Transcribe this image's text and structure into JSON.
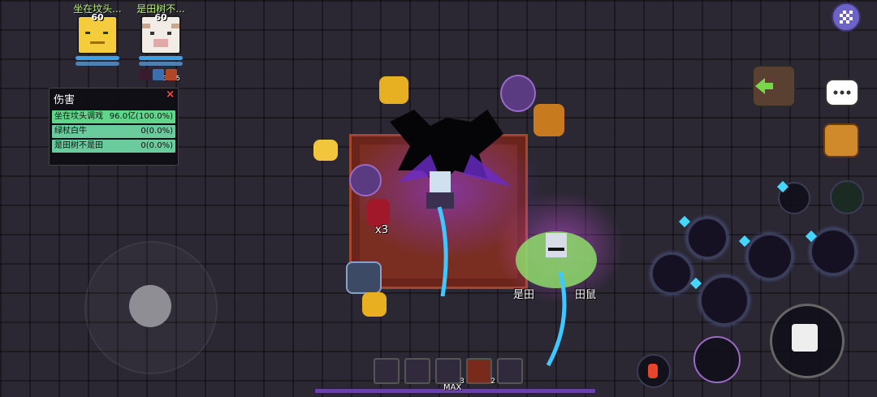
{
  "party": [
    {
      "name": "坐在坟头...",
      "level": "60"
    },
    {
      "name": "是田树不...",
      "level": "60"
    }
  ],
  "buffs": [
    {
      "icon": "dark-buff-icon",
      "count": ""
    },
    {
      "icon": "ice-buff-icon",
      "count": "3"
    },
    {
      "icon": "fire-buff-icon",
      "count": "5"
    }
  ],
  "damage_panel": {
    "title": "伤害",
    "close": "×",
    "rows": [
      {
        "name": "坐在坟头调戏",
        "value": "96.0亿(100.0%)"
      },
      {
        "name": "绿杖白牛",
        "value": "0(0.0%)"
      },
      {
        "name": "是田树不是田",
        "value": "0(0.0%)"
      }
    ]
  },
  "scene": {
    "item_count": "x3",
    "name_tag": "是田",
    "name_tag2": "田鼠"
  },
  "hotbar": [
    {
      "icon": "ghost-item-icon",
      "count": ""
    },
    {
      "icon": "scroll-item-icon",
      "count": ""
    },
    {
      "icon": "cat-item-icon",
      "count": "3"
    },
    {
      "icon": "fire-crystal-icon",
      "count": "2"
    },
    {
      "icon": "heart-potion-icon",
      "count": ""
    }
  ],
  "xp": {
    "label": "MAX",
    "fill": 1.0
  },
  "colors": {
    "player_name": "#b8f27a",
    "damage_bar": "#5fd68a",
    "xp_bar": "#6a3fb0",
    "pause": "#6d63c6"
  }
}
